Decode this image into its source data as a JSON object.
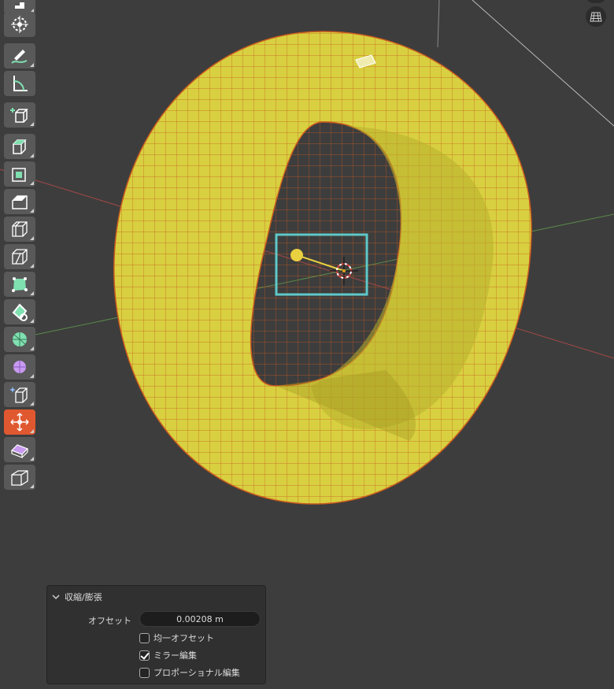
{
  "operator_panel": {
    "title": "収縮/膨張",
    "offset_label": "オフセット",
    "offset_value": "0.00208 m",
    "options": [
      {
        "label": "均一オフセット",
        "checked": false
      },
      {
        "label": "ミラー編集",
        "checked": true
      },
      {
        "label": "プロポーショナル編集",
        "checked": false
      }
    ]
  },
  "toolbar": {
    "tools": [
      {
        "name": "select-box-tool-icon"
      },
      {
        "name": "cursor-tool-icon"
      },
      {
        "name": "annotate-tool-icon"
      },
      {
        "name": "measure-tool-icon"
      },
      {
        "name": "add-cube-tool-icon"
      },
      {
        "name": "extrude-region-tool-icon"
      },
      {
        "name": "inset-faces-tool-icon"
      },
      {
        "name": "bevel-tool-icon"
      },
      {
        "name": "loop-cut-tool-icon"
      },
      {
        "name": "knife-tool-icon"
      },
      {
        "name": "poly-build-tool-icon"
      },
      {
        "name": "spin-tool-icon"
      },
      {
        "name": "smooth-tool-icon"
      },
      {
        "name": "shrink-fatten-sphere-tool-icon"
      },
      {
        "name": "edge-slide-tool-icon"
      },
      {
        "name": "shrink-fatten-tool-icon"
      },
      {
        "name": "shear-tool-icon"
      },
      {
        "name": "rip-region-tool-icon"
      }
    ],
    "active_index": 15
  },
  "colors": {
    "viewport_bg": "#3d3d3d",
    "mesh_fill": "#d8d040",
    "mesh_edge": "#c85a1e",
    "active_tool": "#e0582f",
    "gizmo_box": "#5fc8c8",
    "x_axis": "#a84848",
    "y_axis": "#5a8a4a"
  }
}
